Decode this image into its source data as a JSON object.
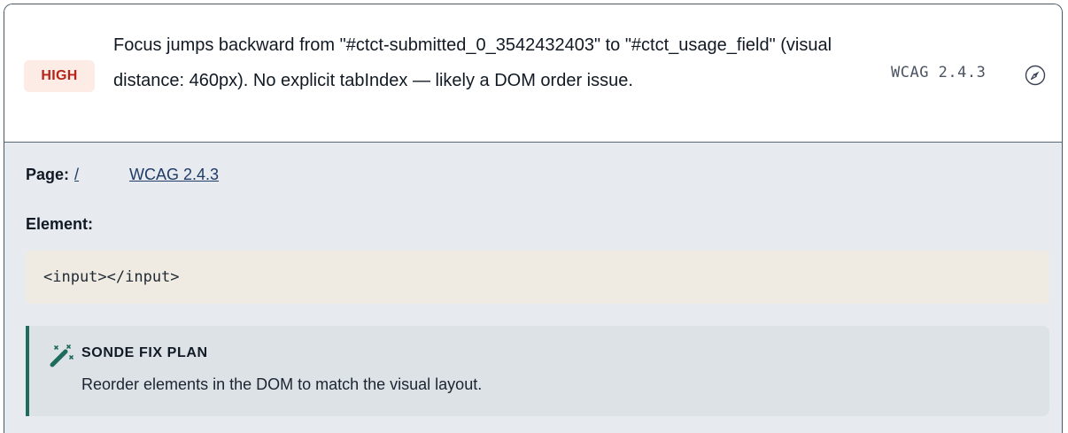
{
  "issue": {
    "severity": "HIGH",
    "message": "Focus jumps backward from \"#ctct-submitted_0_3542432403\" to \"#ctct_usage_field\" (visual distance: 460px). No explicit tabIndex — likely a DOM order issue.",
    "wcag_code": "WCAG 2.4.3",
    "compass_icon": "compass-icon"
  },
  "details": {
    "page_label": "Page:",
    "page_link": "/",
    "wcag_link": "WCAG 2.4.3",
    "element_label": "Element:",
    "element_code": "<input></input>"
  },
  "fix_plan": {
    "icon": "magic-wand-icon",
    "title": "SONDE FIX PLAN",
    "text": "Reorder elements in the DOM to match the visual layout."
  },
  "colors": {
    "severity_text": "#b4261b",
    "severity_bg": "#fdebe6",
    "link": "#1f3b66",
    "fix_accent": "#1f6b5e"
  }
}
